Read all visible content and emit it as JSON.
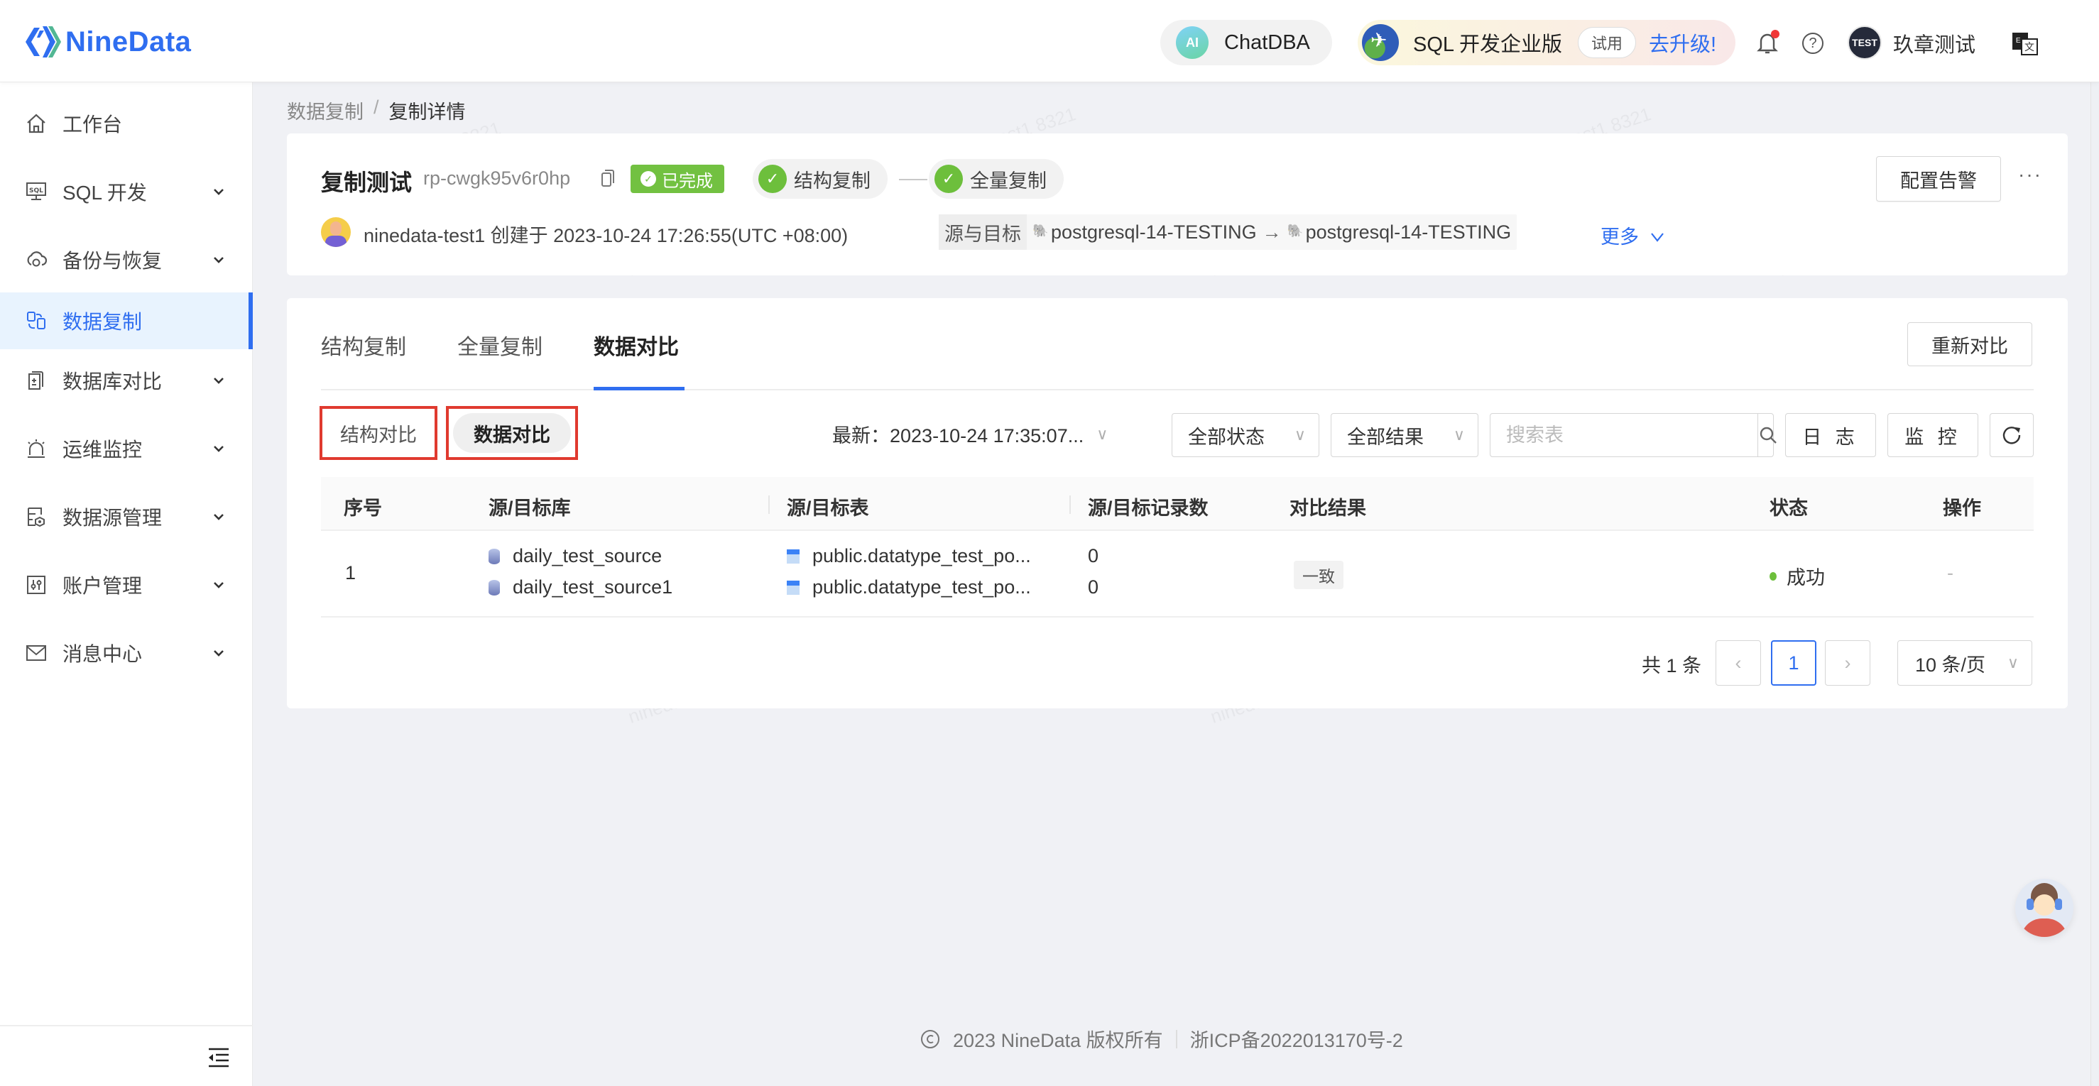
{
  "app": {
    "brand": "NineData",
    "brand_color": "#2f6ef0"
  },
  "topbar": {
    "chatdba_label": "ChatDBA",
    "ai_badge": "AI",
    "edition_label": "SQL 开发企业版",
    "trial_label": "试用",
    "upgrade_label": "去升级!",
    "user_avatar_text": "TEST",
    "user_name": "玖章测试",
    "help_glyph": "?"
  },
  "sidebar": {
    "items": [
      {
        "label": "工作台",
        "icon": "home-icon",
        "expandable": false,
        "active": false
      },
      {
        "label": "SQL 开发",
        "icon": "sql-monitor-icon",
        "expandable": true,
        "active": false
      },
      {
        "label": "备份与恢复",
        "icon": "cloud-sync-icon",
        "expandable": true,
        "active": false
      },
      {
        "label": "数据复制",
        "icon": "data-replication-icon",
        "expandable": false,
        "active": true
      },
      {
        "label": "数据库对比",
        "icon": "db-compare-icon",
        "expandable": true,
        "active": false
      },
      {
        "label": "运维监控",
        "icon": "alarm-icon",
        "expandable": true,
        "active": false
      },
      {
        "label": "数据源管理",
        "icon": "datasource-icon",
        "expandable": true,
        "active": false
      },
      {
        "label": "账户管理",
        "icon": "account-settings-icon",
        "expandable": true,
        "active": false
      },
      {
        "label": "消息中心",
        "icon": "mail-icon",
        "expandable": true,
        "active": false
      }
    ]
  },
  "breadcrumb": {
    "parent": "数据复制",
    "separator": "/",
    "current": "复制详情"
  },
  "task": {
    "title": "复制测试",
    "id": "rp-cwgk95v6r0hp",
    "status": "已完成",
    "status_color": "#72c141",
    "steps": [
      {
        "label": "结构复制",
        "done": true
      },
      {
        "label": "全量复制",
        "done": true
      }
    ],
    "alert_button": "配置告警",
    "more_glyph": "···",
    "creator_line": "ninedata-test1 创建于 2023-10-24 17:26:55(UTC +08:00)",
    "source_target_label": "源与目标",
    "source": "postgresql-14-TESTING",
    "arrow": "→",
    "target": "postgresql-14-TESTING",
    "more_link": "更多"
  },
  "tabs": {
    "items": [
      {
        "label": "结构复制",
        "active": false
      },
      {
        "label": "全量复制",
        "active": false
      },
      {
        "label": "数据对比",
        "active": true
      }
    ],
    "recompare_button": "重新对比"
  },
  "toolbar": {
    "segments": [
      {
        "label": "结构对比",
        "active": false
      },
      {
        "label": "数据对比",
        "active": true
      }
    ],
    "latest_label": "最新：",
    "latest_value": "2023-10-24 17:35:07...",
    "status_filter": "全部状态",
    "result_filter": "全部结果",
    "search_placeholder": "搜索表",
    "search_value": "",
    "log_button": "日 志",
    "monitor_button": "监 控"
  },
  "table": {
    "columns": [
      "序号",
      "源/目标库",
      "源/目标表",
      "源/目标记录数",
      "对比结果",
      "状态",
      "操作"
    ],
    "rows": [
      {
        "index": "1",
        "source_db": "daily_test_source",
        "target_db": "daily_test_source1",
        "source_table": "public.datatype_test_po...",
        "target_table": "public.datatype_test_po...",
        "source_count": "0",
        "target_count": "0",
        "result": "一致",
        "status": "成功",
        "status_color": "#6dbf3c",
        "action": "-"
      }
    ]
  },
  "pagination": {
    "total_label": "共 1 条",
    "current_page": "1",
    "prev_glyph": "‹",
    "next_glyph": "›",
    "page_size": "10 条/页"
  },
  "footer": {
    "copyright": "2023 NineData 版权所有",
    "icp": "浙ICP备2022013170号-2"
  },
  "watermark": "ninedata-test1 8321"
}
